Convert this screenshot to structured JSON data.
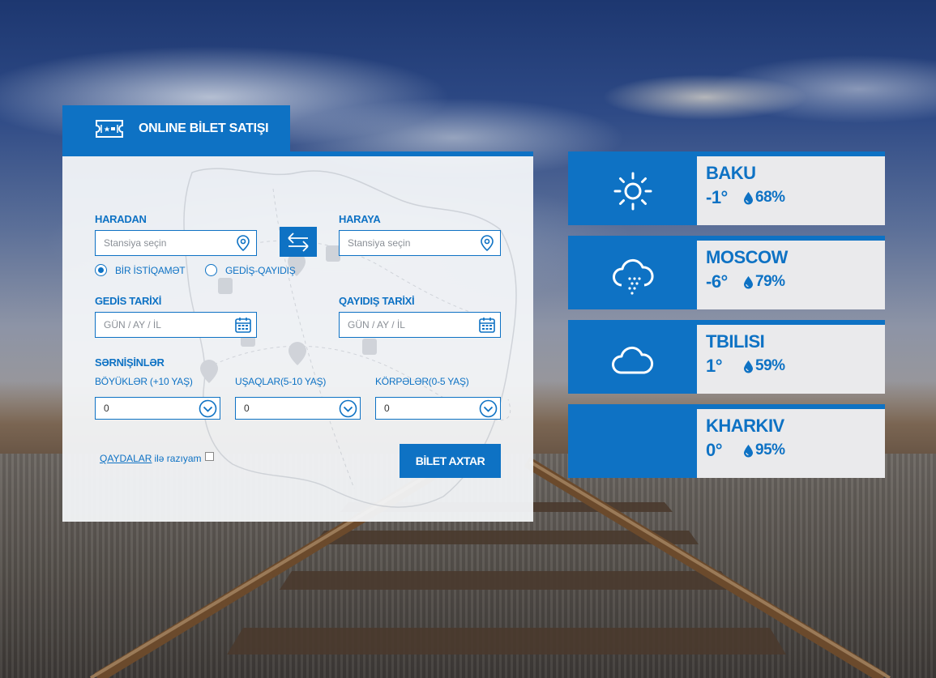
{
  "booking": {
    "title": "ONLINE BİLET SATIŞI",
    "from_label": "HARADAN",
    "to_label": "HARAYA",
    "from_placeholder": "Stansiya seçin",
    "to_placeholder": "Stansiya seçin",
    "trip_type": {
      "one_way": "BİR İSTİQAMƏT",
      "round_trip": "GEDİŞ-QAYIDIŞ",
      "selected": "one_way"
    },
    "departure_label": "GEDİS TARİXİ",
    "return_label": "QAYIDIŞ TARİXİ",
    "date_placeholder": "GÜN / AY / İL",
    "passengers_label": "SƏRNİŞİNLƏR",
    "adults_label": "BÖYÜKLƏR (+10 YAŞ)",
    "children_label": "UŞAQLAR(5-10 YAŞ)",
    "infants_label": "KÖRPƏLƏR(0-5 YAŞ)",
    "adults_value": "0",
    "children_value": "0",
    "infants_value": "0",
    "rules_link": "QAYDALAR",
    "agree_text": "ilə razıyam",
    "search_button": "BİLET AXTAR"
  },
  "weather": [
    {
      "city": "BAKU",
      "temp": "-1°",
      "humidity": "68%",
      "icon": "sun-icon"
    },
    {
      "city": "MOSCOW",
      "temp": "-6°",
      "humidity": "79%",
      "icon": "snow-cloud-icon"
    },
    {
      "city": "TBILISI",
      "temp": "1°",
      "humidity": "59%",
      "icon": "cloud-icon"
    },
    {
      "city": "KHARKIV",
      "temp": "0°",
      "humidity": "95%",
      "icon": ""
    }
  ],
  "colors": {
    "primary": "#0e72c4",
    "panel": "#f4f6f9",
    "card_info": "#eaeaec"
  }
}
